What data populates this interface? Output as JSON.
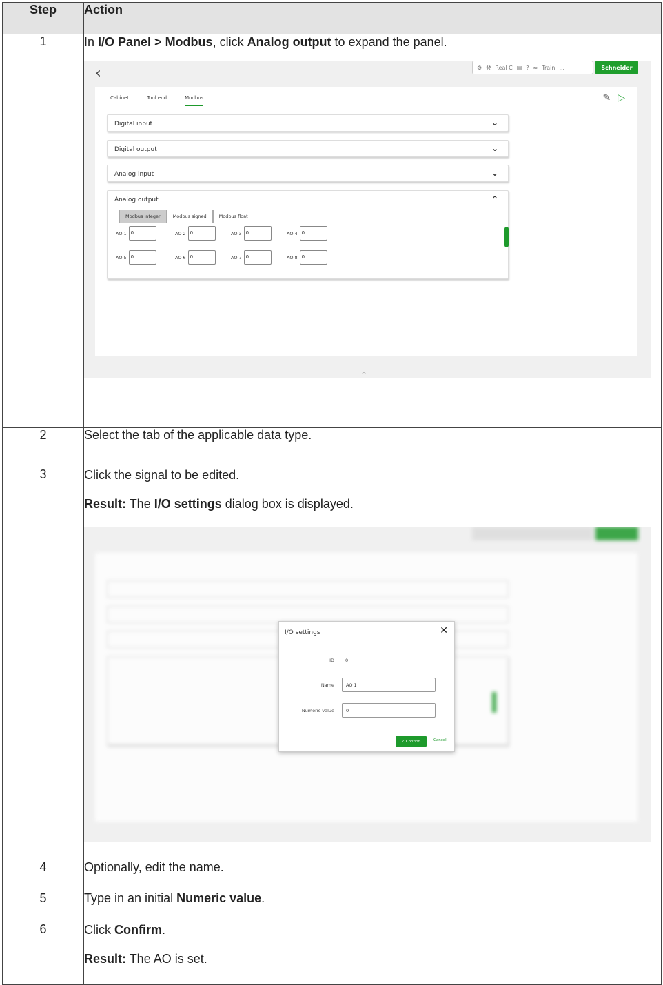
{
  "table": {
    "header": {
      "step": "Step",
      "action": "Action"
    },
    "rows": [
      {
        "num": "1",
        "text": {
          "p1": "In ",
          "b1": "I/O Panel",
          "sep": " > ",
          "b2": "Modbus",
          "p2": ", click ",
          "b3": "Analog output",
          "p3": " to expand the panel."
        }
      },
      {
        "num": "2",
        "text": "Select the tab of the applicable data type."
      },
      {
        "num": "3",
        "text": "Click the signal to be edited.",
        "result_label": "Result:",
        "result_p1": " The ",
        "result_b": "I/O settings",
        "result_p2": " dialog box is displayed."
      },
      {
        "num": "4",
        "text": "Optionally, edit the name."
      },
      {
        "num": "5",
        "p1": "Type in an initial ",
        "b": "Numeric value",
        "p2": "."
      },
      {
        "num": "6",
        "p1": "Click ",
        "b": "Confirm",
        "p2": ".",
        "result_label": "Result:",
        "result_text": " The AO is set."
      }
    ]
  },
  "screen1": {
    "tray": {
      "real": "Real C",
      "help": "?",
      "train": "Train",
      "more": "..."
    },
    "brand": "Schneider",
    "tabs": [
      "Cabinet",
      "Tool end",
      "Modbus"
    ],
    "accordions": [
      "Digital input",
      "Digital output",
      "Analog input",
      "Analog output"
    ],
    "subtabs": [
      "Modbus integer",
      "Modbus signed",
      "Modbus float"
    ],
    "ao_fields": [
      {
        "label": "AO 1",
        "value": "0"
      },
      {
        "label": "AO 2",
        "value": "0"
      },
      {
        "label": "AO 3",
        "value": "0"
      },
      {
        "label": "AO 4",
        "value": "0"
      },
      {
        "label": "AO 5",
        "value": "0"
      },
      {
        "label": "AO 6",
        "value": "0"
      },
      {
        "label": "AO 7",
        "value": "0"
      },
      {
        "label": "AO 8",
        "value": "0"
      }
    ]
  },
  "dialog": {
    "title": "I/O settings",
    "id_label": "ID",
    "id_value": "0",
    "name_label": "Name",
    "name_value": "AO 1",
    "numeric_label": "Numeric value",
    "numeric_value": "0",
    "confirm": "✓ Confirm",
    "cancel": "Cancel"
  },
  "colors": {
    "accent": "#1e9a2c",
    "header_bg": "#e3e3e3"
  }
}
